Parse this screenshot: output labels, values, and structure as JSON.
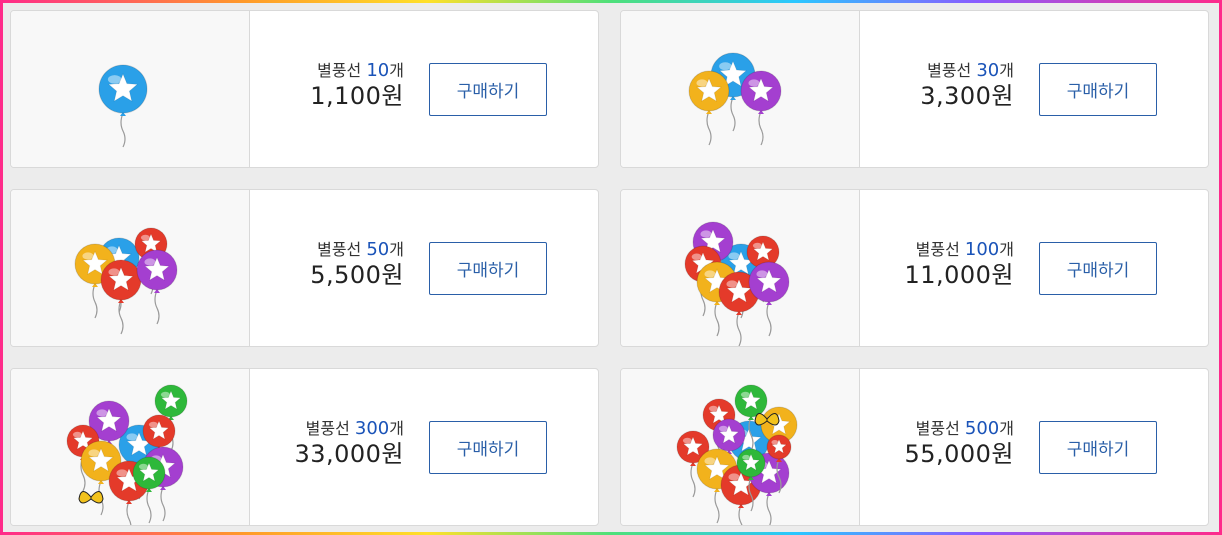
{
  "products": [
    {
      "prefix": "별풍선",
      "count": "10",
      "suffix": "개",
      "price": "1,100원",
      "button": "구매하기"
    },
    {
      "prefix": "별풍선",
      "count": "30",
      "suffix": "개",
      "price": "3,300원",
      "button": "구매하기"
    },
    {
      "prefix": "별풍선",
      "count": "50",
      "suffix": "개",
      "price": "5,500원",
      "button": "구매하기"
    },
    {
      "prefix": "별풍선",
      "count": "100",
      "suffix": "개",
      "price": "11,000원",
      "button": "구매하기"
    },
    {
      "prefix": "별풍선",
      "count": "300",
      "suffix": "개",
      "price": "33,000원",
      "button": "구매하기"
    },
    {
      "prefix": "별풍선",
      "count": "500",
      "suffix": "개",
      "price": "55,000원",
      "button": "구매하기"
    }
  ],
  "colors": {
    "accent": "#1a53b8",
    "button_border": "#2a5fa8",
    "balloon_blue": "#2aa0e8",
    "balloon_yellow": "#f2b21c",
    "balloon_purple": "#a43fd0",
    "balloon_red": "#e43a2a",
    "balloon_green": "#2eb83a"
  },
  "icons": [
    "star-balloon-icon",
    "butterfly-icon"
  ]
}
